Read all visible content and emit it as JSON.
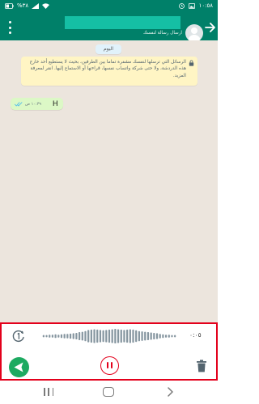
{
  "status_bar": {
    "time": "١٠:٥٨",
    "battery": "%٣٨"
  },
  "header": {
    "subtitle": "ارسال رسالة لنفسك"
  },
  "chat": {
    "date_label": "اليوم",
    "encryption_notice": "الرسائل التي ترسلها لنفسك مشفرة تماما بين الطرفين، بحيث لا يستطيع أحد خارج هذه الدردشة، ولا حتى شركة واتساب نفسها، قراءتها أو الاستماع إليها. انقر لمعرفة المزيد.",
    "messages": [
      {
        "text": "H",
        "time": "١٠:٣٩ ص",
        "status": "read"
      }
    ]
  },
  "recorder": {
    "duration": "٠:٠٥",
    "waveform_levels": [
      0.15,
      0.15,
      0.2,
      0.2,
      0.25,
      0.2,
      0.25,
      0.3,
      0.3,
      0.35,
      0.4,
      0.45,
      0.55,
      0.6,
      0.7,
      0.85,
      0.9,
      0.95,
      0.9,
      0.85,
      0.8,
      0.85,
      0.9,
      0.95,
      1,
      0.95,
      0.9,
      0.85,
      0.9,
      0.95,
      0.9,
      0.8,
      0.7,
      0.65,
      0.6,
      0.55,
      0.5,
      0.45,
      0.4,
      0.3,
      0.25,
      0.2,
      0.2,
      0.15,
      0.15
    ]
  },
  "colors": {
    "brand": "#008069",
    "send": "#1daa61",
    "highlight": "#e3001b",
    "chat_bg": "#ece5dd",
    "outgoing_bubble": "#dcf8c6",
    "notice_bg": "#fff5c4",
    "read_ticks": "#53bdeb"
  },
  "icons": {
    "status_left": [
      "image-icon",
      "clock-icon"
    ],
    "status_right": [
      "battery-icon",
      "signal-icon",
      "wifi-icon"
    ],
    "header": [
      "more-vert-icon",
      "avatar-icon",
      "back-arrow-icon"
    ],
    "notice": "lock-icon",
    "message": "double-check-icon",
    "recorder": [
      "dismiss-icon",
      "send-icon",
      "pause-icon",
      "trash-icon"
    ],
    "nav": [
      "recents-icon",
      "home-icon",
      "back-icon"
    ]
  }
}
